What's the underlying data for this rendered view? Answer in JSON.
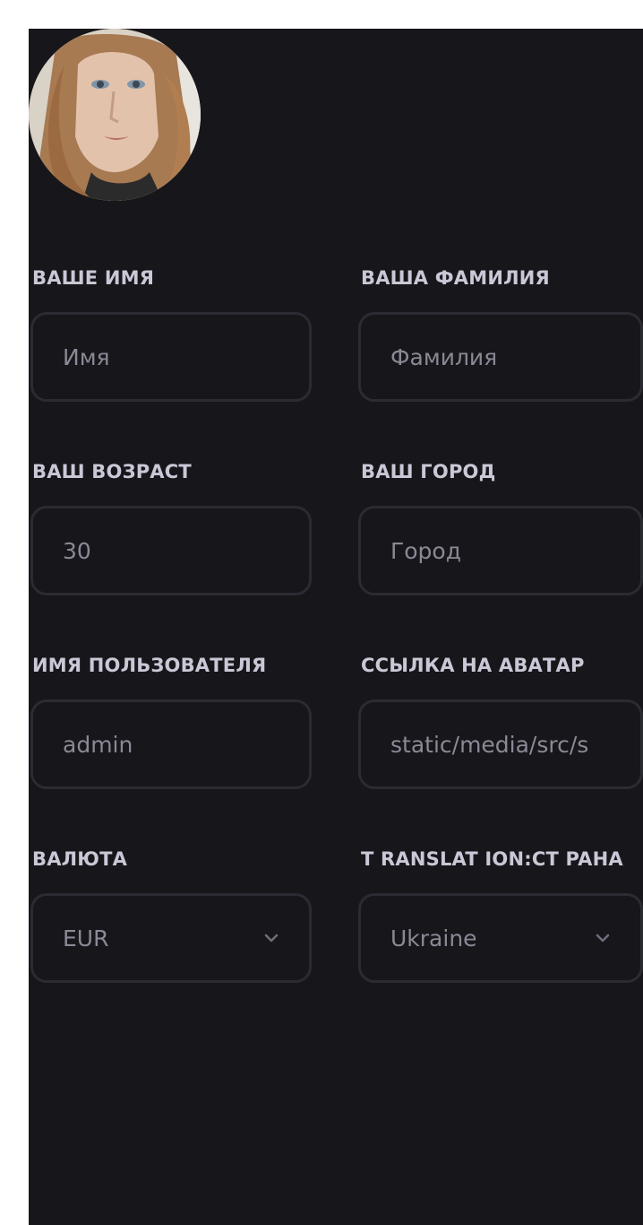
{
  "profile": {
    "avatar_alt": "avatar"
  },
  "fields": {
    "first_name": {
      "label": "ВАШЕ ИМЯ",
      "placeholder": "Имя",
      "value": ""
    },
    "last_name": {
      "label": "ВАША ФАМИЛИЯ",
      "placeholder": "Фамилия",
      "value": ""
    },
    "age": {
      "label": "ВАШ ВОЗРАСТ",
      "placeholder": "",
      "value": "30"
    },
    "city": {
      "label": "ВАШ ГОРОД",
      "placeholder": "Город",
      "value": ""
    },
    "username": {
      "label": "ИМЯ ПОЛЬЗОВАТЕЛЯ",
      "placeholder": "",
      "value": "admin"
    },
    "avatar_link": {
      "label": "ССЫЛКА НА АВАТАР",
      "placeholder": "",
      "value": "static/media/src/s"
    },
    "currency": {
      "label": "ВАЛЮТА",
      "selected": "EUR"
    },
    "country": {
      "label": "T RANSLAT ION:CT PAHA",
      "selected": "Ukraine"
    }
  },
  "icons": {
    "select_chevron": "chevron-down-icon"
  },
  "colors": {
    "panel_background": "#17161a",
    "label_text": "#c9c8d6",
    "input_text": "#8a8996",
    "input_border": "#2b2b33"
  }
}
